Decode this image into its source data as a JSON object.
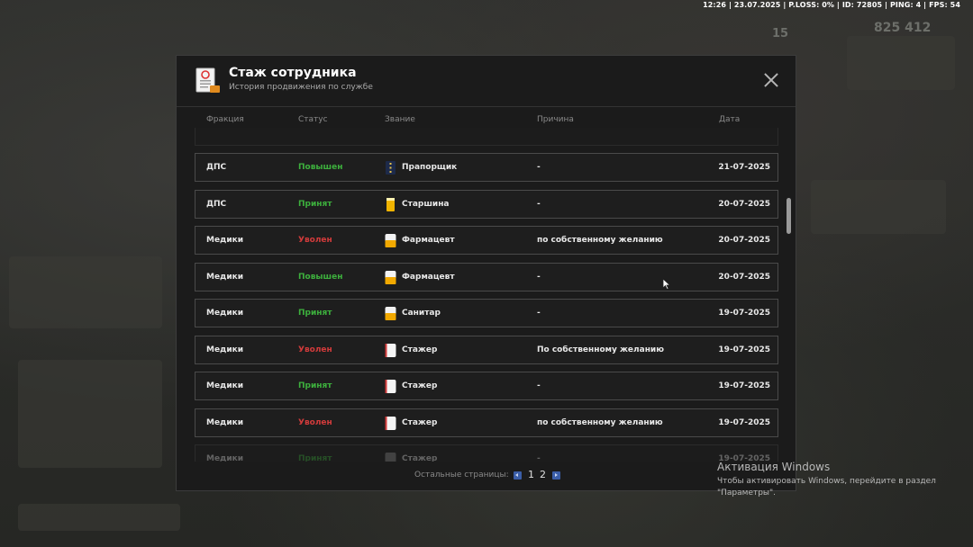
{
  "hud": {
    "text": "12:26 | 23.07.2025 | P.LOSS: 0% | ID: 72805 | PING: 4 | FPS: 54"
  },
  "background": {
    "money": "825 412",
    "level": "15"
  },
  "modal": {
    "title": "Стаж сотрудника",
    "subtitle": "История продвижения по службе",
    "columns": {
      "faction": "Фракция",
      "status": "Статус",
      "rank": "Звание",
      "reason": "Причина",
      "date": "Дата"
    },
    "rows": [
      {
        "faction": "ДПС",
        "status": "Повышен",
        "status_type": "green",
        "rank": "Прапорщик",
        "rank_icon": "navy-rank-icon",
        "reason": "-",
        "date": "21-07-2025"
      },
      {
        "faction": "ДПС",
        "status": "Принят",
        "status_type": "green",
        "rank": "Старшина",
        "rank_icon": "yellow-stripe-icon",
        "reason": "-",
        "date": "20-07-2025"
      },
      {
        "faction": "Медики",
        "status": "Уволен",
        "status_type": "red",
        "rank": "Фармацевт",
        "rank_icon": "yellow-white-icon",
        "reason": "по собственному желанию",
        "date": "20-07-2025"
      },
      {
        "faction": "Медики",
        "status": "Повышен",
        "status_type": "green",
        "rank": "Фармацевт",
        "rank_icon": "yellow-white-icon",
        "reason": "-",
        "date": "20-07-2025"
      },
      {
        "faction": "Медики",
        "status": "Принят",
        "status_type": "green",
        "rank": "Санитар",
        "rank_icon": "yellow-white-icon",
        "reason": "-",
        "date": "19-07-2025"
      },
      {
        "faction": "Медики",
        "status": "Уволен",
        "status_type": "red",
        "rank": "Стажер",
        "rank_icon": "white-red-icon",
        "reason": "По собственному желанию",
        "date": "19-07-2025"
      },
      {
        "faction": "Медики",
        "status": "Принят",
        "status_type": "green",
        "rank": "Стажер",
        "rank_icon": "white-red-icon",
        "reason": "-",
        "date": "19-07-2025"
      },
      {
        "faction": "Медики",
        "status": "Уволен",
        "status_type": "red",
        "rank": "Стажер",
        "rank_icon": "white-red-icon",
        "reason": "по собственному желанию",
        "date": "19-07-2025"
      },
      {
        "faction": "Медики",
        "status": "Принят",
        "status_type": "green",
        "rank": "Стажер",
        "rank_icon": "gray-icon",
        "reason": "-",
        "date": "19-07-2025"
      }
    ],
    "pager": {
      "label": "Остальные страницы:",
      "pages": [
        "1",
        "2"
      ],
      "current": "1"
    }
  },
  "activation": {
    "title": "Активация Windows",
    "line1": "Чтобы активировать Windows, перейдите в раздел",
    "line2": "\"Параметры\"."
  },
  "colors": {
    "green": "#3db03d",
    "red": "#d23b3b",
    "accent": "#3b5ea8"
  }
}
